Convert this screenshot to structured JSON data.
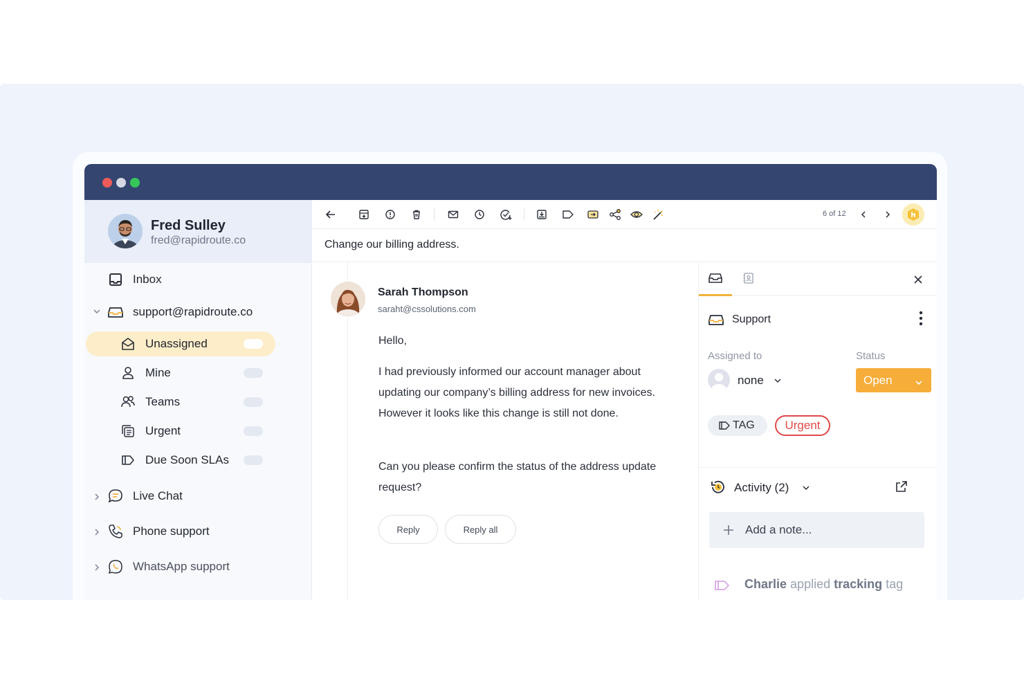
{
  "profile": {
    "name": "Fred Sulley",
    "email": "fred@rapidroute.co"
  },
  "sidebar": {
    "inbox_label": "Inbox",
    "account_label": "support@rapidroute.co",
    "sub_items": [
      {
        "label": "Unassigned",
        "icon": "envelope-open-icon",
        "active": true
      },
      {
        "label": "Mine",
        "icon": "user-icon"
      },
      {
        "label": "Teams",
        "icon": "users-icon"
      },
      {
        "label": "Urgent",
        "icon": "stack-icon"
      },
      {
        "label": "Due Soon SLAs",
        "icon": "tag-icon"
      }
    ],
    "channels": [
      {
        "label": "Live Chat",
        "icon": "chat-bubble-icon"
      },
      {
        "label": "Phone support",
        "icon": "phone-icon"
      },
      {
        "label": "WhatsApp support",
        "icon": "whatsapp-icon"
      }
    ]
  },
  "toolbar": {
    "pager": "6 of 12"
  },
  "email": {
    "subject": "Change our billing address.",
    "sender_name": "Sarah Thompson",
    "sender_email": "saraht@cssolutions.com",
    "greeting": "Hello,",
    "paragraph1": "I had previously informed our account manager about updating our company’s billing address for new invoices. However it looks like this change is still not done.",
    "paragraph2": "Can you please confirm the status of the address update request?",
    "reply_label": "Reply",
    "reply_all_label": "Reply all"
  },
  "details": {
    "inbox_name": "Support",
    "assigned_label": "Assigned to",
    "assigned_value": "none",
    "status_label": "Status",
    "status_value": "Open",
    "tag_label": "TAG",
    "tag_value": "Urgent",
    "activity_label": "Activity (2)",
    "note_placeholder": "Add a note...",
    "log": {
      "actor": "Charlie",
      "verb": "applied",
      "tag": "tracking",
      "suffix": "tag"
    }
  },
  "colors": {
    "titlebar": "#344570",
    "accent": "#f6ad3a",
    "urgent": "#e04848",
    "active_item": "#fdedc8"
  }
}
